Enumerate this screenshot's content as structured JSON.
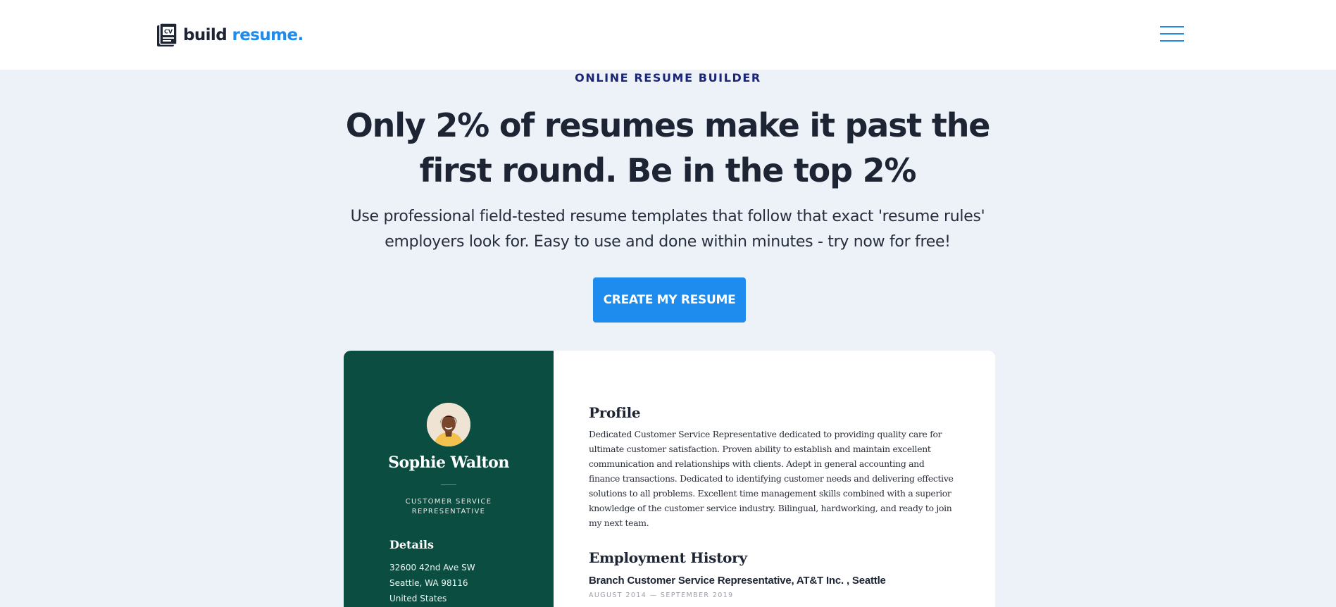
{
  "brand": {
    "name_part1": "build",
    "name_part2": "resume.",
    "accent_color": "#1e8bef",
    "logo_icon": "cv-document-icon",
    "logo_mark_text": "CV"
  },
  "nav": {
    "menu_icon": "hamburger-menu-icon"
  },
  "hero": {
    "eyebrow": "ONLINE RESUME BUILDER",
    "headline": "Only 2% of resumes make it past the first round. Be in the top 2%",
    "subheadline": "Use professional field-tested resume templates that follow that exact 'resume rules' employers look for. Easy to use and done within minutes - try now for free!",
    "cta_label": "CREATE MY RESUME"
  },
  "resume_preview": {
    "sidebar_color": "#0c4d41",
    "avatar_icon": "profile-photo-avatar",
    "name": "Sophie Walton",
    "title": "CUSTOMER SERVICE REPRESENTATIVE",
    "details_heading": "Details",
    "details": [
      "32600 42nd Ave SW",
      "Seattle, WA 98116",
      "United States"
    ],
    "profile_heading": "Profile",
    "profile_text": "Dedicated Customer Service Representative dedicated to providing quality care for ultimate customer satisfaction. Proven ability to establish and maintain excellent communication and relationships with clients. Adept in general accounting and finance transactions. Dedicated to identifying customer needs and delivering effective solutions to all problems. Excellent time management skills combined with a superior knowledge of the customer service industry. Bilingual, hardworking, and ready to join my next team.",
    "employment_heading": "Employment History",
    "job_title": "Branch Customer Service Representative, AT&T Inc. , Seattle",
    "job_dates": "AUGUST 2014 — SEPTEMBER 2019"
  }
}
